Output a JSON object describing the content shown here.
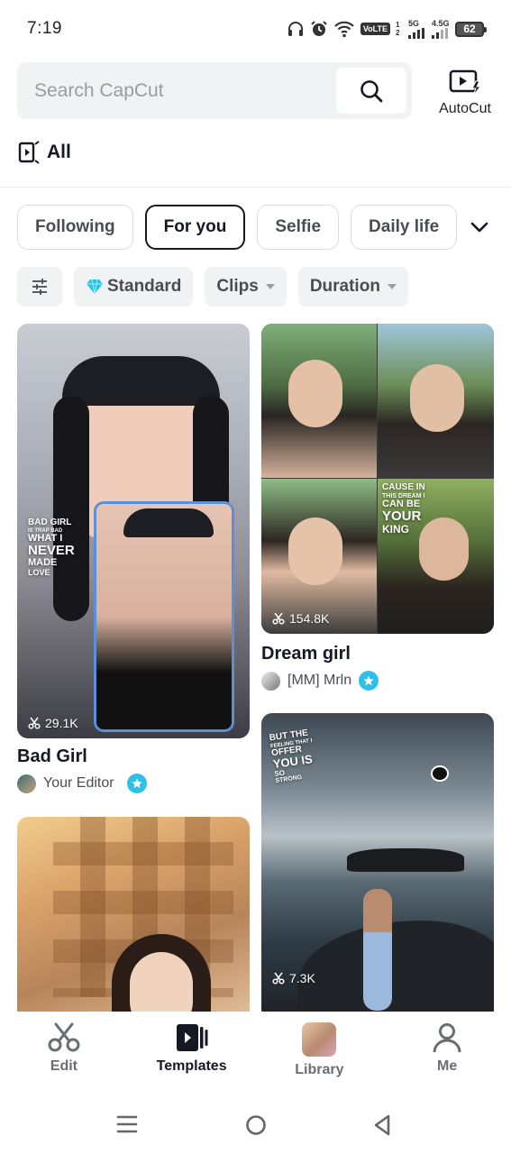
{
  "status_bar": {
    "time": "7:19",
    "volte": "VoLTE",
    "sim_slots": "1 2",
    "net1": "5G",
    "net2": "4.5G",
    "battery": "62"
  },
  "search": {
    "placeholder": "Search CapCut",
    "value": ""
  },
  "autocut": {
    "label": "AutoCut"
  },
  "all_label": "All",
  "tabs": [
    {
      "label": "Following",
      "active": false
    },
    {
      "label": "For you",
      "active": true
    },
    {
      "label": "Selfie",
      "active": false
    },
    {
      "label": "Daily life",
      "active": false
    }
  ],
  "filters": {
    "standard": "Standard",
    "clips": "Clips",
    "duration": "Duration"
  },
  "feed": {
    "cards": [
      {
        "title": "Bad Girl",
        "author": "Your Editor",
        "uses": "29.1K",
        "overlay": [
          "BAD GIRL",
          "IS TRAP BAD",
          "WHAT I",
          "NEVER",
          "MADE",
          "LOVE"
        ]
      },
      {
        "title": "Dream girl",
        "author": "[MM] Mrln",
        "uses": "154.8K",
        "overlay": [
          "CAUSE IN",
          "THIS DREAM I",
          "CAN BE",
          "YOUR",
          "KING"
        ]
      },
      {
        "title": "",
        "author": "",
        "uses": "7.3K",
        "overlay": [
          "BUT THE",
          "FEELING THAT I",
          "OFFER",
          "YOU IS",
          "SO",
          "STRONG"
        ]
      }
    ]
  },
  "bottom_nav": {
    "edit": "Edit",
    "templates": "Templates",
    "library": "Library",
    "me": "Me"
  },
  "colors": {
    "accent_verified": "#2ec1e8",
    "diamond": "#27c4e6",
    "text_primary": "#161823",
    "chip_bg": "#f1f2f4"
  },
  "icons": [
    "scissors-icon",
    "search-icon",
    "autocut-icon",
    "diamond-icon",
    "filter-sliders-icon",
    "chevron-down-icon",
    "edit-scissors-icon",
    "templates-icon",
    "person-icon"
  ]
}
